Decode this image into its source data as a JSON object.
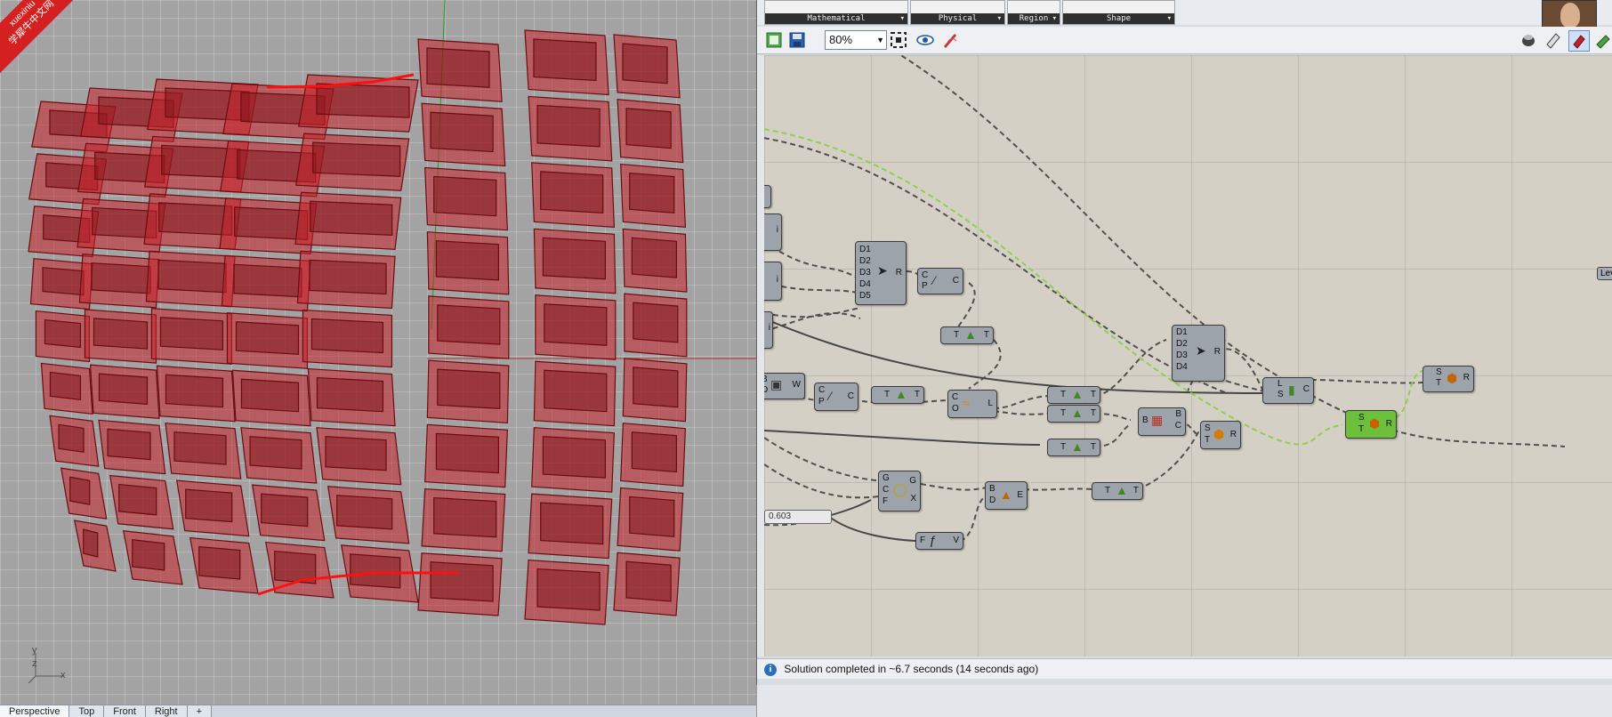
{
  "viewport": {
    "watermark_line1": "xuexiniu",
    "watermark_line2": "学犀牛中文网",
    "axis_x": "x",
    "axis_y": "y",
    "axis_z": "z",
    "tabs": [
      {
        "label": "Perspective",
        "active": true
      },
      {
        "label": "Top",
        "active": false
      },
      {
        "label": "Front",
        "active": false
      },
      {
        "label": "Right",
        "active": false
      },
      {
        "label": "+",
        "active": false
      }
    ],
    "model_color": "#c8232a",
    "annotation_color": "#ff1010"
  },
  "grasshopper": {
    "ribbon_groups": [
      {
        "label": "Mathematical"
      },
      {
        "label": "Physical"
      },
      {
        "label": "Region"
      },
      {
        "label": "Shape"
      }
    ],
    "toolbar": {
      "zoom": "80%",
      "icons": [
        "new-file-icon",
        "save-icon",
        "zoom-extents-icon",
        "preview-eye-icon",
        "sketch-icon",
        "preview-mode-icon",
        "wireframe-icon",
        "shaded-icon",
        "bake-icon"
      ]
    },
    "status": {
      "message": "Solution completed in ~6.7 seconds (14 seconds ago)"
    },
    "slider": {
      "value": "0.603"
    },
    "level_tag": "Level",
    "components": {
      "merge1": {
        "inputs": [
          "D1",
          "D2",
          "D3",
          "D4",
          "D5"
        ],
        "output": "R"
      },
      "merge2": {
        "inputs": [
          "D1",
          "D2",
          "D3",
          "D4"
        ],
        "output": "R"
      },
      "curve_cp": {
        "inputs": [
          "C",
          "P"
        ],
        "output": "C"
      },
      "curve_cp2": {
        "inputs": [
          "C",
          "P"
        ],
        "output": "C"
      },
      "tree1": {
        "inputs": [
          "T"
        ],
        "output": "T"
      },
      "tree2": {
        "inputs": [
          "T"
        ],
        "output": "T"
      },
      "tree3": {
        "inputs": [
          "T"
        ],
        "output": "T"
      },
      "tree4": {
        "inputs": [
          "T"
        ],
        "output": "T"
      },
      "tree5": {
        "inputs": [
          "T"
        ],
        "output": "T"
      },
      "tree6": {
        "inputs": [
          "T"
        ],
        "output": "T"
      },
      "loft": {
        "inputs": [
          "C",
          "O"
        ],
        "output": "L"
      },
      "box": {
        "inputs": [
          "B",
          "D"
        ],
        "output": "W"
      },
      "gcf": {
        "inputs": [
          "G",
          "C",
          "F"
        ],
        "outputs": [
          "G",
          "X"
        ]
      },
      "bd": {
        "inputs": [
          "B",
          "D"
        ],
        "output": "E"
      },
      "ls": {
        "inputs": [
          "L",
          "S"
        ],
        "output": "C"
      },
      "bbc": {
        "inputs": [
          "B"
        ],
        "outputs": [
          "B",
          "C"
        ]
      },
      "st1": {
        "inputs": [
          "S",
          "T"
        ],
        "output": "R"
      },
      "st2": {
        "inputs": [
          "S",
          "T"
        ],
        "output": "R"
      },
      "st3": {
        "inputs": [
          "S",
          "T"
        ],
        "output": "R"
      },
      "fv": {
        "inputs": [
          "F"
        ],
        "output": "V"
      },
      "stub_i1": {
        "output": "i"
      },
      "stub_i2": {
        "output": "i"
      },
      "stub_i3": {
        "output": "i"
      }
    },
    "wire_color": "#505050",
    "selected_wire_color": "#8fcf4a",
    "component_color": "#9da3ab",
    "active_component_color": "#6ec03c"
  }
}
